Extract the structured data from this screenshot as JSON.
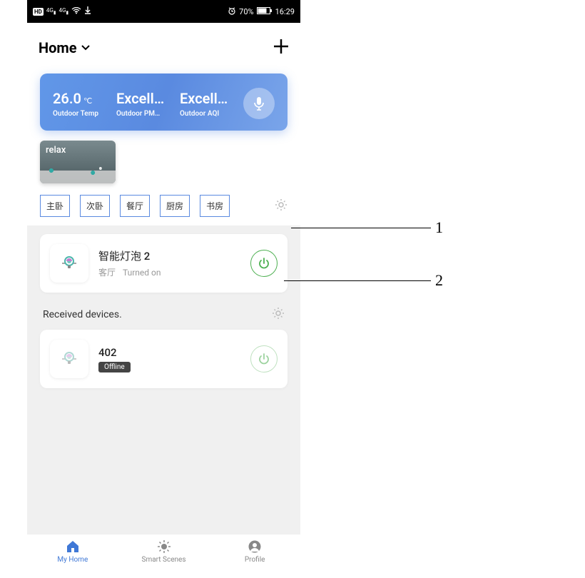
{
  "statusbar": {
    "hd": "HD",
    "sig1": "4G",
    "sig2": "4G",
    "alarm_icon": "⏰",
    "battery_pct": "70%",
    "time": "16:29"
  },
  "header": {
    "home_label": "Home"
  },
  "weather": {
    "temp_value": "26.0",
    "temp_unit": "℃",
    "temp_label": "Outdoor Temp",
    "pm_value": "Excell…",
    "pm_label": "Outdoor PM…",
    "aqi_value": "Excell…",
    "aqi_label": "Outdoor AQI"
  },
  "scene": {
    "label": "relax"
  },
  "rooms": [
    "主卧",
    "次卧",
    "餐厅",
    "厨房",
    "书房"
  ],
  "devices": [
    {
      "name": "智能灯泡 2",
      "room": "客厅",
      "status": "Turned on",
      "online": true
    }
  ],
  "received_section": {
    "title": "Received devices."
  },
  "received_devices": [
    {
      "name": "402",
      "status": "Offline",
      "online": false
    }
  ],
  "nav": {
    "home": "My Home",
    "scenes": "Smart Scenes",
    "profile": "Profile"
  },
  "annotations": {
    "a1": "1",
    "a2": "2"
  }
}
